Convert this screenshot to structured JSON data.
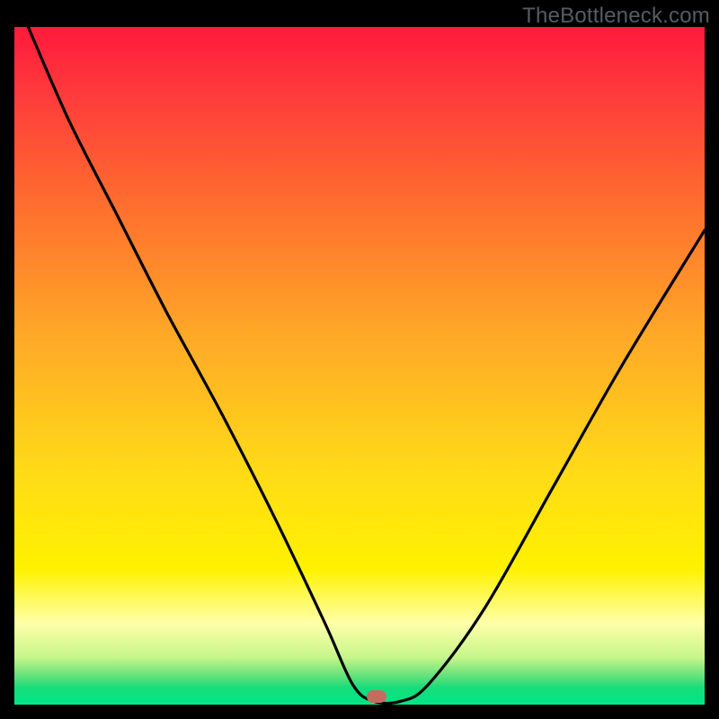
{
  "watermark": "TheBottleneck.com",
  "marker": {
    "x_frac": 0.525,
    "y_frac": 0.988,
    "color": "#c76a5f"
  },
  "chart_data": {
    "type": "line",
    "title": "",
    "xlabel": "",
    "ylabel": "",
    "xlim": [
      0,
      1
    ],
    "ylim": [
      0,
      1
    ],
    "grid": false,
    "legend": false,
    "annotations": [
      "TheBottleneck.com"
    ],
    "series": [
      {
        "name": "bottleneck-curve",
        "x": [
          0.02,
          0.08,
          0.15,
          0.22,
          0.3,
          0.38,
          0.45,
          0.49,
          0.52,
          0.56,
          0.6,
          0.68,
          0.78,
          0.88,
          1.0
        ],
        "y": [
          1.0,
          0.86,
          0.72,
          0.58,
          0.43,
          0.27,
          0.12,
          0.03,
          0.005,
          0.005,
          0.03,
          0.14,
          0.32,
          0.5,
          0.7
        ]
      }
    ],
    "background_gradient": {
      "stops": [
        {
          "pos": 0.0,
          "color": "#ff1a3c"
        },
        {
          "pos": 0.1,
          "color": "#ff3b3b"
        },
        {
          "pos": 0.25,
          "color": "#ff6a2f"
        },
        {
          "pos": 0.45,
          "color": "#ffa727"
        },
        {
          "pos": 0.65,
          "color": "#ffd918"
        },
        {
          "pos": 0.8,
          "color": "#fff200"
        },
        {
          "pos": 0.88,
          "color": "#ffffaa"
        },
        {
          "pos": 0.93,
          "color": "#c6f68a"
        },
        {
          "pos": 0.96,
          "color": "#5be07a"
        },
        {
          "pos": 0.975,
          "color": "#17dd7b"
        },
        {
          "pos": 1.0,
          "color": "#00e686"
        }
      ]
    },
    "marker": {
      "x": 0.525,
      "y": 0.012,
      "shape": "pill",
      "color": "#c76a5f"
    }
  }
}
